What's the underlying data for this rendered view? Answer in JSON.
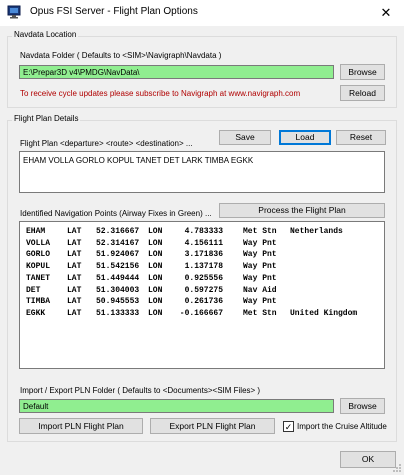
{
  "window": {
    "title": "Opus FSI Server - Flight Plan Options",
    "close_glyph": "✕"
  },
  "navdata": {
    "group_title": "Navdata Location",
    "folder_label": "Navdata Folder ( Defaults to <SIM>\\Navigraph\\Navdata )",
    "folder_value": "E:\\Prepar3D v4\\PMDG\\NavData\\",
    "browse_label": "Browse",
    "reload_label": "Reload",
    "notice": "To receive cycle updates please subscribe to Navigraph at www.navigraph.com"
  },
  "flight_plan": {
    "group_title": "Flight Plan Details",
    "plan_label": "Flight Plan <departure> <route> <destination> ...",
    "save_label": "Save",
    "load_label": "Load",
    "reset_label": "Reset",
    "plan_value": "EHAM VOLLA GORLO KOPUL TANET DET LARK TIMBA EGKK",
    "nav_points_label": "Identified Navigation Points (Airway Fixes in Green) ...",
    "process_label": "Process the Flight Plan",
    "nav_points": [
      {
        "id": "EHAM",
        "lat_tag": "LAT",
        "lat": "52.316667",
        "lon_tag": "LON",
        "lon": "4.783333",
        "type": "Met Stn",
        "country": "Netherlands"
      },
      {
        "id": "VOLLA",
        "lat_tag": "LAT",
        "lat": "52.314167",
        "lon_tag": "LON",
        "lon": "4.156111",
        "type": "Way Pnt",
        "country": ""
      },
      {
        "id": "GORLO",
        "lat_tag": "LAT",
        "lat": "51.924067",
        "lon_tag": "LON",
        "lon": "3.171836",
        "type": "Way Pnt",
        "country": ""
      },
      {
        "id": "KOPUL",
        "lat_tag": "LAT",
        "lat": "51.542156",
        "lon_tag": "LON",
        "lon": "1.137178",
        "type": "Way Pnt",
        "country": ""
      },
      {
        "id": "TANET",
        "lat_tag": "LAT",
        "lat": "51.449444",
        "lon_tag": "LON",
        "lon": "0.925556",
        "type": "Way Pnt",
        "country": ""
      },
      {
        "id": "DET",
        "lat_tag": "LAT",
        "lat": "51.304003",
        "lon_tag": "LON",
        "lon": "0.597275",
        "type": "Nav Aid",
        "country": ""
      },
      {
        "id": "TIMBA",
        "lat_tag": "LAT",
        "lat": "50.945553",
        "lon_tag": "LON",
        "lon": "0.261736",
        "type": "Way Pnt",
        "country": ""
      },
      {
        "id": "EGKK",
        "lat_tag": "LAT",
        "lat": "51.133333",
        "lon_tag": "LON",
        "lon": "-0.166667",
        "type": "Met Stn",
        "country": "United Kingdom"
      }
    ]
  },
  "pln": {
    "folder_label": "Import / Export PLN Folder ( Defaults to <Documents><SIM Files> )",
    "folder_value": "Default",
    "browse_label": "Browse",
    "import_label": "Import PLN Flight Plan",
    "export_label": "Export PLN Flight Plan",
    "cruise_label": "Import the Cruise Altitude",
    "cruise_checked": true,
    "check_glyph": "✓"
  },
  "footer": {
    "ok_label": "OK"
  },
  "colors": {
    "accent": "#0078d7",
    "field_green": "#90ee90",
    "notice_red": "#b00000"
  }
}
